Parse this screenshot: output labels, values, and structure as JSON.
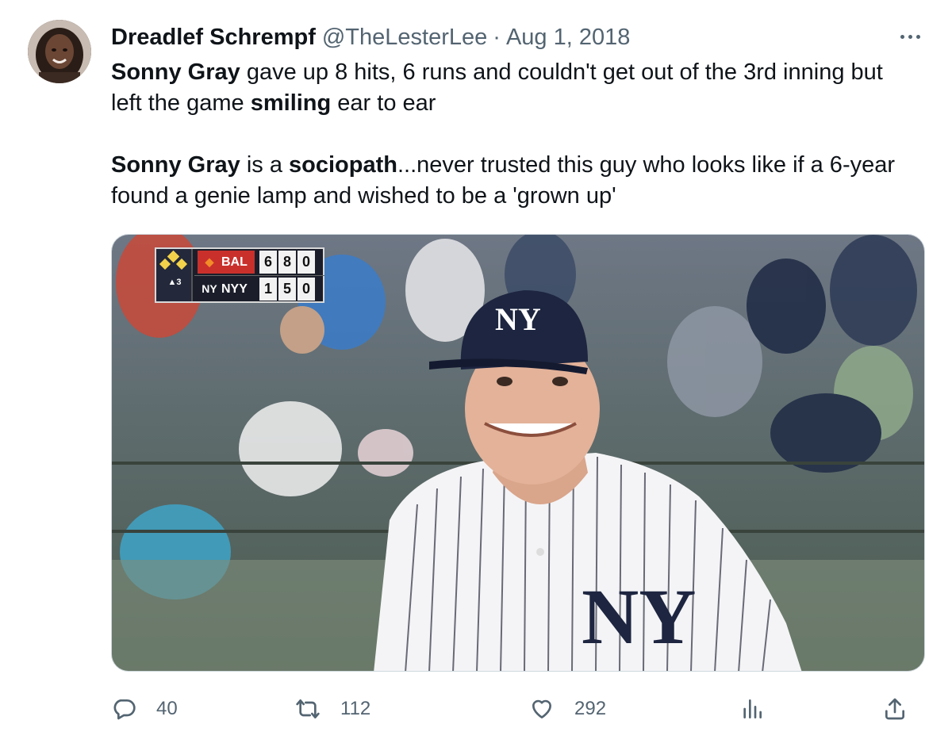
{
  "tweet": {
    "author": {
      "display_name": "Dreadlef Schrempf",
      "handle": "@TheLesterLee",
      "separator": "·",
      "date": "Aug 1, 2018",
      "avatar": "user-avatar"
    },
    "paragraphs": [
      [
        {
          "text": "Sonny Gray",
          "bold": true
        },
        {
          "text": " gave up 8 hits, 6 runs and couldn't get out of the 3rd inning but left the game ",
          "bold": false
        },
        {
          "text": "smiling",
          "bold": true
        },
        {
          "text": " ear to ear",
          "bold": false
        }
      ],
      [
        {
          "text": "Sonny Gray",
          "bold": true
        },
        {
          "text": " is a ",
          "bold": false
        },
        {
          "text": "sociopath",
          "bold": true
        },
        {
          "text": "...never trusted this guy who looks like if a 6-year found a genie lamp and wished to be a 'grown up'",
          "bold": false
        }
      ]
    ],
    "media": {
      "description": "Baseball pitcher in pinstriped uniform smiling on field",
      "scorebug": {
        "inning": "▲3",
        "teams": [
          {
            "abbr": "BAL",
            "logo": "bird",
            "r": "6",
            "h": "8",
            "e": "0"
          },
          {
            "abbr": "NYY",
            "logo": "NY",
            "r": "1",
            "h": "5",
            "e": "0"
          }
        ],
        "cap_logo": "NY",
        "jersey_logo": "NY"
      }
    },
    "actions": {
      "reply": {
        "icon": "reply-icon",
        "count": "40"
      },
      "retweet": {
        "icon": "retweet-icon",
        "count": "112"
      },
      "like": {
        "icon": "heart-icon",
        "count": "292"
      },
      "views": {
        "icon": "views-icon"
      },
      "share": {
        "icon": "share-icon"
      }
    },
    "more_icon": "more-icon"
  },
  "colors": {
    "text_primary": "#0f1419",
    "text_secondary": "#536471",
    "border": "#cfd9de",
    "scorebug_away": "#c9302c"
  }
}
